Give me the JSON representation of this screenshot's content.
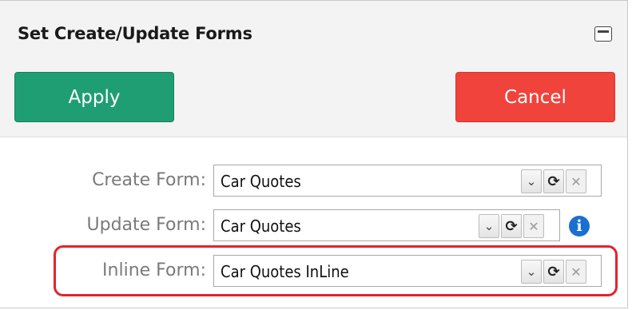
{
  "dialog": {
    "title": "Set Create/Update Forms",
    "maximize_icon": "maximize-icon"
  },
  "buttons": {
    "apply_label": "Apply",
    "cancel_label": "Cancel",
    "apply_color": "#1f9e74",
    "cancel_color": "#f0433b"
  },
  "fields": {
    "create": {
      "label": "Create Form:",
      "value": "Car Quotes"
    },
    "update": {
      "label": "Update Form:",
      "value": "Car Quotes"
    },
    "inline": {
      "label": "Inline Form:",
      "value": "Car Quotes InLine"
    }
  },
  "icons": {
    "dropdown": "chevron-down-icon",
    "refresh": "refresh-icon",
    "clear": "close-icon",
    "info": "info-icon"
  },
  "highlight_color": "#e3242b"
}
